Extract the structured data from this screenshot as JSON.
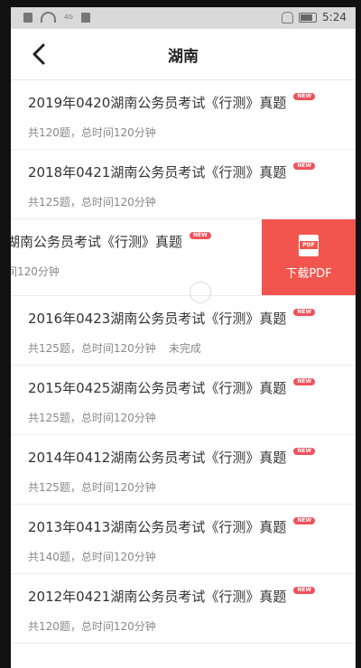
{
  "statusbar": {
    "network_label": "4G",
    "time": "5:24"
  },
  "nav": {
    "title": "湖南"
  },
  "badge_text": "NEW",
  "swipe_action": {
    "pdf_tag": "PDF",
    "label": "下载PDF"
  },
  "items": [
    {
      "title": "2019年0420湖南公务员考试《行测》真题",
      "meta": "共120题，总时间120分钟",
      "status": ""
    },
    {
      "title": "2018年0421湖南公务员考试《行测》真题",
      "meta": "共125题，总时间120分钟",
      "status": ""
    },
    {
      "title": "湖南公务员考试《行测》真题",
      "meta": "间120分钟",
      "status": ""
    },
    {
      "title": "2016年0423湖南公务员考试《行测》真题",
      "meta": "共125题，总时间120分钟",
      "status": "未完成"
    },
    {
      "title": "2015年0425湖南公务员考试《行测》真题",
      "meta": "共125题，总时间120分钟",
      "status": ""
    },
    {
      "title": "2014年0412湖南公务员考试《行测》真题",
      "meta": "共125题，总时间120分钟",
      "status": ""
    },
    {
      "title": "2013年0413湖南公务员考试《行测》真题",
      "meta": "共140题，总时间120分钟",
      "status": ""
    },
    {
      "title": "2012年0421湖南公务员考试《行测》真题",
      "meta": "共120题，总时间120分钟",
      "status": ""
    }
  ]
}
